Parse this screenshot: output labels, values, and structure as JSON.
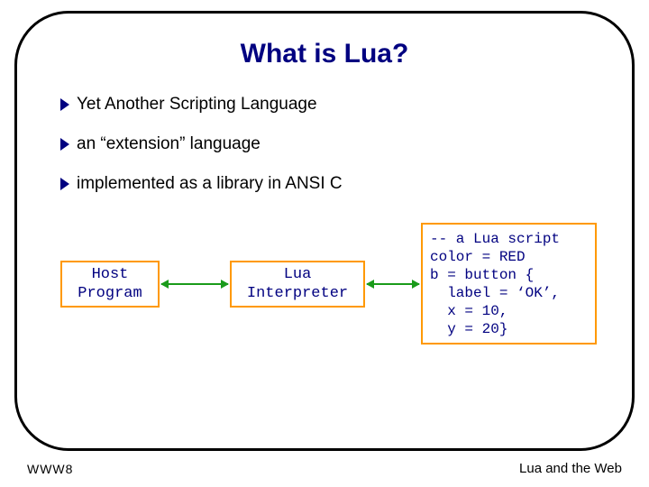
{
  "title": "What is Lua?",
  "bullets": [
    "Yet Another Scripting Language",
    "an “extension” language",
    "implemented as a library in ANSI C"
  ],
  "diagram": {
    "host": "Host\nProgram",
    "interpreter": "Lua\nInterpreter",
    "script": "-- a Lua script\ncolor = RED\nb = button {\n  label = ‘OK’,\n  x = 10,\n  y = 20}"
  },
  "footer": {
    "left": "WWW8",
    "right": "Lua and the Web"
  }
}
